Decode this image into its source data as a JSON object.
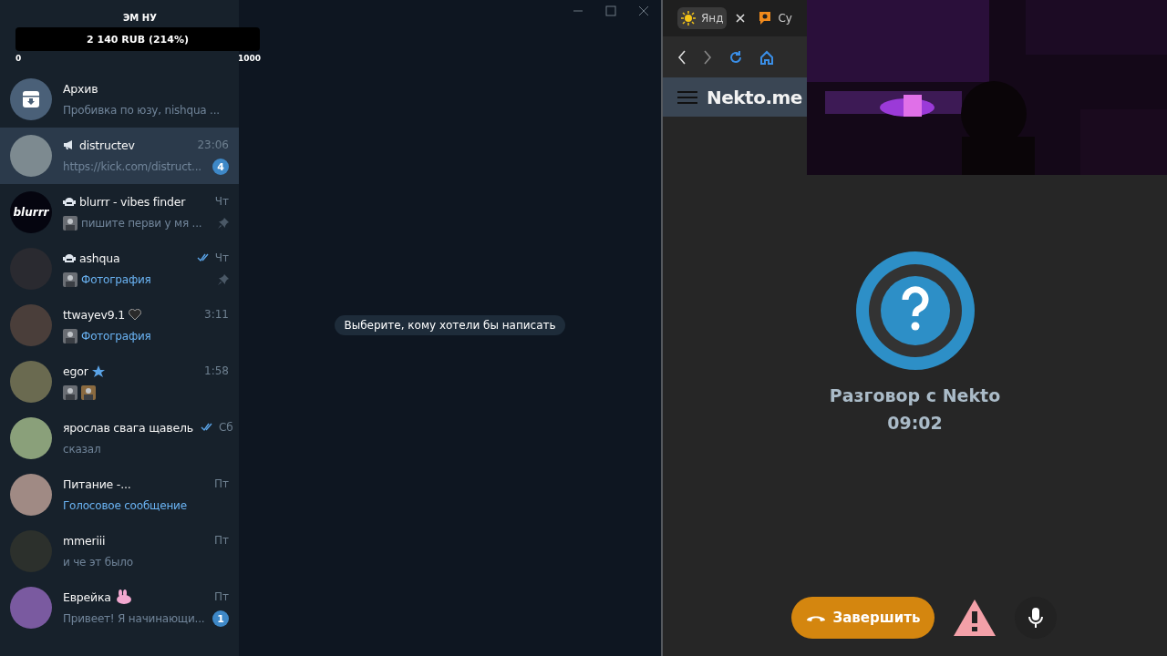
{
  "goal": {
    "title": "ЭМ НУ",
    "amount": "2 140 RUB (214%)",
    "level": 1,
    "min": "0",
    "max": "1000"
  },
  "chats": [
    {
      "kind": "archive",
      "name": "Архив",
      "preview": "Пробивка по юзу, nishqua ...",
      "selected": false
    },
    {
      "kind": "chat",
      "name": "distructev",
      "time": "23:06",
      "preview": "https://kick.com/distruct...",
      "unread": "4",
      "selected": true
    },
    {
      "kind": "chat",
      "name": "blurrr - vibes finder",
      "avatar_text": "blurrr",
      "time": "Чт",
      "preview": "пишите перви у мя ...",
      "pinned": true,
      "selected": false
    },
    {
      "kind": "chat",
      "name": "ashqua",
      "time": "Чт",
      "read": true,
      "preview": "Фотография",
      "pinned": true,
      "selected": false
    },
    {
      "kind": "chat",
      "name": "ttwayev9.1",
      "time": "3:11",
      "preview": "Фотография",
      "selected": false
    },
    {
      "kind": "chat",
      "name": "egor",
      "time": "1:58",
      "selected": false
    },
    {
      "kind": "chat",
      "name": "ярослав свага щавель",
      "time": "Сб",
      "read": true,
      "preview": "сказал",
      "selected": false
    },
    {
      "kind": "chat",
      "name": "Питание -...",
      "time": "Пт",
      "preview": "Голосовое сообщение",
      "selected": false
    },
    {
      "kind": "chat",
      "name": "mmeriii",
      "time": "Пт",
      "preview": "и че эт было",
      "selected": false
    },
    {
      "kind": "chat",
      "name": "Еврейка",
      "time": "Пт",
      "preview": "Привеет! Я начинающи...",
      "unread": "1",
      "selected": false
    }
  ],
  "main": {
    "hint": "Выберите, кому хотели бы написать"
  },
  "browser": {
    "tabs": [
      {
        "label": "Янд",
        "selected": true
      },
      {
        "label": "Су",
        "selected": false
      }
    ],
    "site": {
      "logo": "Nekto.me"
    },
    "call": {
      "title": "Разговор с Nekto",
      "time": "09:02",
      "end_button": "Завершить"
    }
  }
}
